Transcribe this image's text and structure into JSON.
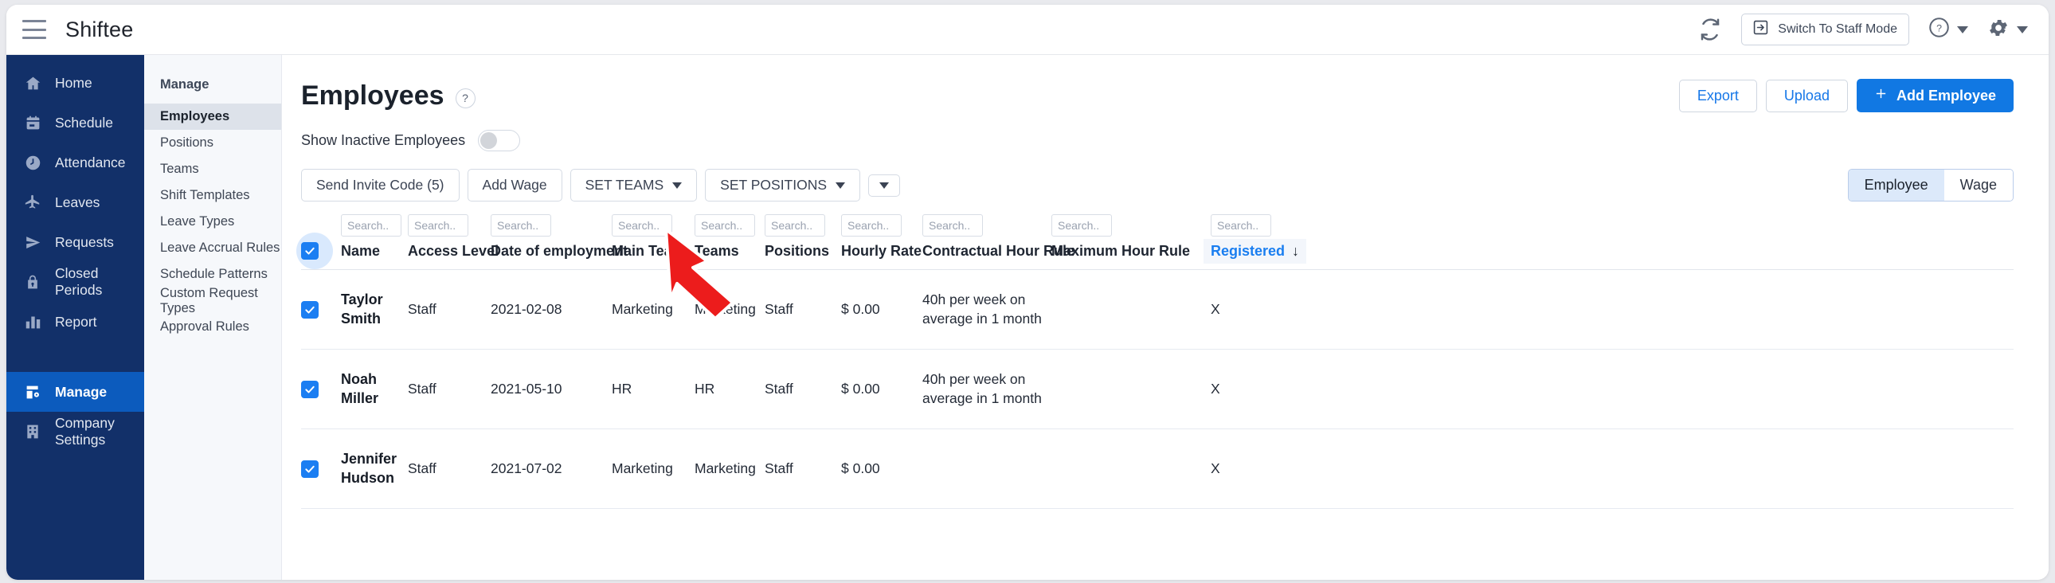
{
  "topbar": {
    "brand": "Shiftee",
    "menu_icon": "hamburger-icon",
    "refresh_icon": "refresh-icon",
    "switch_mode_label": "Switch To Staff Mode",
    "switch_mode_icon": "sign-in-icon",
    "help_icon": "question-circle-icon",
    "settings_icon": "gear-icon"
  },
  "sidebar": {
    "items": [
      {
        "label": "Home",
        "icon": "home-icon",
        "active": false
      },
      {
        "label": "Schedule",
        "icon": "calendar-icon",
        "active": false
      },
      {
        "label": "Attendance",
        "icon": "clock-icon",
        "active": false
      },
      {
        "label": "Leaves",
        "icon": "plane-icon",
        "active": false
      },
      {
        "label": "Requests",
        "icon": "send-icon",
        "active": false
      },
      {
        "label": "Closed Periods",
        "icon": "lock-icon",
        "active": false
      },
      {
        "label": "Report",
        "icon": "bar-chart-icon",
        "active": false
      },
      {
        "label": "Manage",
        "icon": "manage-icon",
        "active": true
      },
      {
        "label": "Company Settings",
        "icon": "building-icon",
        "active": false
      }
    ]
  },
  "subnav": {
    "title": "Manage",
    "items": [
      {
        "label": "Employees",
        "active": true
      },
      {
        "label": "Positions",
        "active": false
      },
      {
        "label": "Teams",
        "active": false
      },
      {
        "label": "Shift Templates",
        "active": false
      },
      {
        "label": "Leave Types",
        "active": false
      },
      {
        "label": "Leave Accrual Rules",
        "active": false
      },
      {
        "label": "Schedule Patterns",
        "active": false
      },
      {
        "label": "Custom Request Types",
        "active": false
      },
      {
        "label": "Approval Rules",
        "active": false
      }
    ]
  },
  "page": {
    "title": "Employees",
    "help_badge": "?",
    "export_label": "Export",
    "upload_label": "Upload",
    "add_employee_label": "Add Employee",
    "add_employee_icon": "plus-icon",
    "show_inactive_label": "Show Inactive Employees",
    "show_inactive_on": false
  },
  "toolbar": {
    "send_invite_label": "Send Invite Code (5)",
    "add_wage_label": "Add Wage",
    "set_teams_label": "SET TEAMS",
    "set_positions_label": "SET POSITIONS",
    "more_icon": "chevron-down-icon",
    "segment": {
      "employee_label": "Employee",
      "wage_label": "Wage",
      "selected": "Employee"
    }
  },
  "table": {
    "search_placeholder": "Search..",
    "columns": [
      {
        "key": "name",
        "label": "Name",
        "search": true,
        "sorted": false
      },
      {
        "key": "acc",
        "label": "Access Level",
        "search": true,
        "sorted": false
      },
      {
        "key": "doe",
        "label": "Date of employment",
        "search": true,
        "sorted": false
      },
      {
        "key": "main",
        "label": "Main Team",
        "search": true,
        "sorted": false
      },
      {
        "key": "team",
        "label": "Teams",
        "search": true,
        "sorted": false
      },
      {
        "key": "pos",
        "label": "Positions",
        "search": true,
        "sorted": false
      },
      {
        "key": "rate",
        "label": "Hourly Rate",
        "search": true,
        "sorted": false
      },
      {
        "key": "chr",
        "label": "Contractual Hour Rule",
        "search": true,
        "sorted": false
      },
      {
        "key": "mhr",
        "label": "Maximum Hour Rule",
        "search": true,
        "sorted": false
      },
      {
        "key": "reg",
        "label": "Registered",
        "search": true,
        "sorted": true
      }
    ],
    "sort_icon": "arrow-down-icon",
    "header_checked": true,
    "rows": [
      {
        "checked": true,
        "name": "Taylor Smith",
        "acc": "Staff",
        "doe": "2021-02-08",
        "main": "Marketing",
        "team": "Marketing",
        "pos": "Staff",
        "rate": "$ 0.00",
        "chr": "40h per week on average in 1 month",
        "mhr": "",
        "reg": "X"
      },
      {
        "checked": true,
        "name": "Noah Miller",
        "acc": "Staff",
        "doe": "2021-05-10",
        "main": "HR",
        "team": "HR",
        "pos": "Staff",
        "rate": "$ 0.00",
        "chr": "40h per week on average in 1 month",
        "mhr": "",
        "reg": "X"
      },
      {
        "checked": true,
        "name": "Jennifer Hudson",
        "acc": "Staff",
        "doe": "2021-07-02",
        "main": "Marketing",
        "team": "Marketing",
        "pos": "Staff",
        "rate": "$ 0.00",
        "chr": "",
        "mhr": "",
        "reg": "X"
      }
    ]
  },
  "annotation": {
    "arrow_color": "#ec1c1c",
    "points_at": "send-invite-code-button"
  },
  "colors": {
    "sidebar_bg": "#123069",
    "sidebar_active": "#0c5bbd",
    "primary": "#1178e3",
    "link": "#1677e8",
    "sort_blue": "#1a7ef0"
  }
}
